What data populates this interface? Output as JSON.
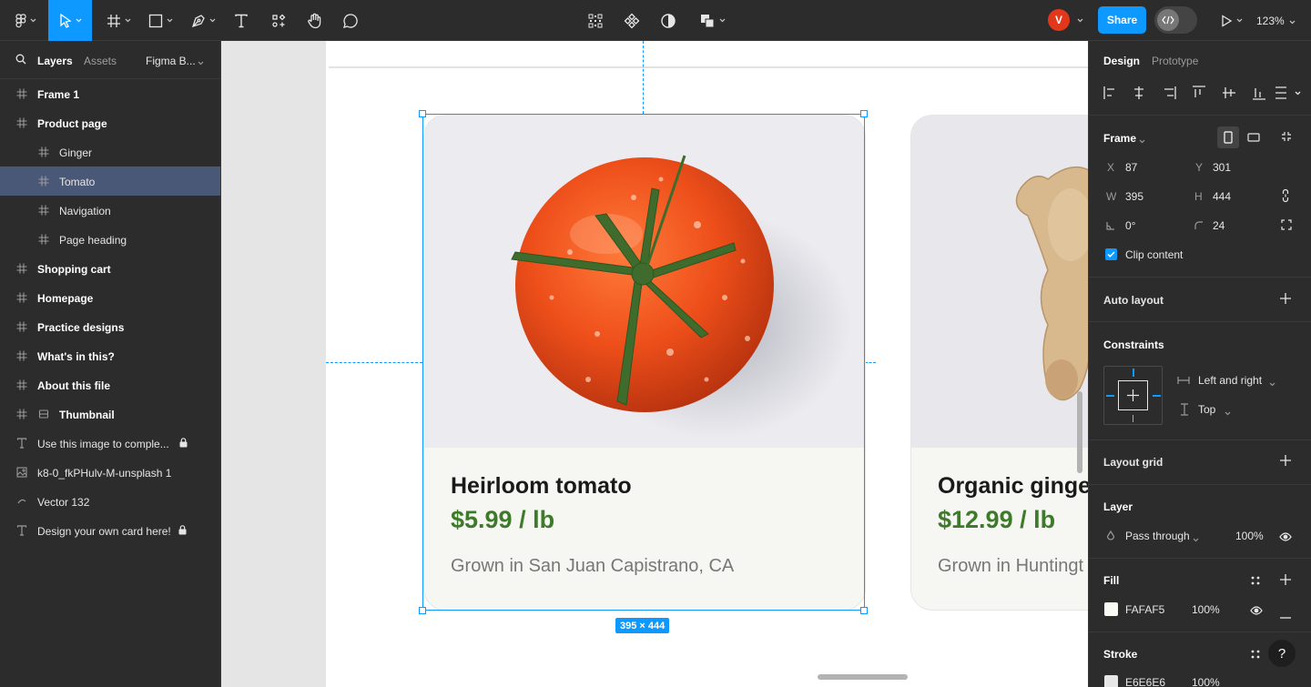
{
  "toolbar": {
    "share_label": "Share",
    "avatar_initial": "V",
    "zoom": "123%"
  },
  "left_panel": {
    "tabs": {
      "layers": "Layers",
      "assets": "Assets",
      "page": "Figma B..."
    },
    "layers": [
      {
        "label": "Frame 1",
        "icon": "frame-icon",
        "bold": true
      },
      {
        "label": "Product page",
        "icon": "frame-icon",
        "bold": true
      },
      {
        "label": "Ginger",
        "icon": "frame-icon",
        "bold": false
      },
      {
        "label": "Tomato",
        "icon": "frame-icon",
        "bold": false,
        "selected": true
      },
      {
        "label": "Navigation",
        "icon": "frame-icon",
        "bold": false
      },
      {
        "label": "Page heading",
        "icon": "frame-icon",
        "bold": false
      },
      {
        "label": "Shopping cart",
        "icon": "frame-icon",
        "bold": true
      },
      {
        "label": "Homepage",
        "icon": "frame-icon",
        "bold": true
      },
      {
        "label": "Practice designs",
        "icon": "frame-icon",
        "bold": true
      },
      {
        "label": "What's in this?",
        "icon": "frame-icon",
        "bold": true
      },
      {
        "label": "About this file",
        "icon": "frame-icon",
        "bold": true
      },
      {
        "label": "Thumbnail",
        "icon": "frame-icon",
        "bold": true
      },
      {
        "label": "Use this image to comple...",
        "icon": "text-icon",
        "bold": false,
        "locked": true
      },
      {
        "label": "k8-0_fkPHulv-M-unsplash 1",
        "icon": "image-icon",
        "bold": false
      },
      {
        "label": "Vector 132",
        "icon": "vector-icon",
        "bold": false
      },
      {
        "label": "Design your own card here!",
        "icon": "text-icon",
        "bold": false,
        "locked": true
      }
    ]
  },
  "canvas": {
    "cards": [
      {
        "title": "Heirloom tomato",
        "price": "$5.99 / lb",
        "location": "Grown in San Juan Capistrano, CA"
      },
      {
        "title": "Organic ginge",
        "price": "$12.99 / lb",
        "location": "Grown in Huntingt"
      }
    ],
    "dimension_badge": "395 × 444"
  },
  "right_panel": {
    "tabs": {
      "design": "Design",
      "prototype": "Prototype"
    },
    "frame": {
      "title": "Frame",
      "x_label": "X",
      "x": "87",
      "y_label": "Y",
      "y": "301",
      "w_label": "W",
      "w": "395",
      "h_label": "H",
      "h": "444",
      "rotation": "0°",
      "radius": "24",
      "clip_content": "Clip content"
    },
    "auto_layout": "Auto layout",
    "constraints": {
      "title": "Constraints",
      "horizontal": "Left and right",
      "vertical": "Top"
    },
    "layout_grid": "Layout grid",
    "layer": {
      "title": "Layer",
      "blend": "Pass through",
      "opacity": "100%"
    },
    "fill": {
      "title": "Fill",
      "hex": "FAFAF5",
      "opacity": "100%",
      "color": "#FAFAF5"
    },
    "stroke": {
      "title": "Stroke",
      "hex": "E6E6E6",
      "opacity": "100%",
      "color": "#E6E6E6"
    }
  }
}
